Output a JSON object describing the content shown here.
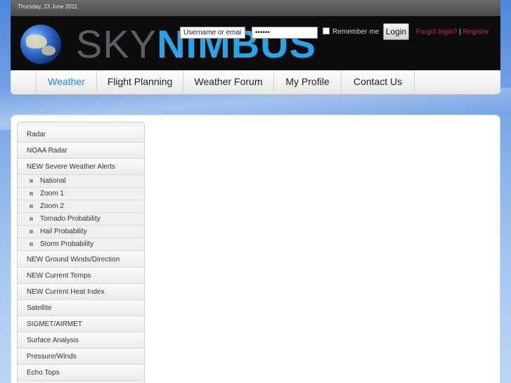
{
  "topbar": {
    "date": "Thursday, 23 June 2011"
  },
  "header": {
    "logo_sky": "SKY",
    "logo_nimbus": "NIMBUS",
    "login": {
      "username_placeholder": "Username or email",
      "password_value": "••••••",
      "remember_label": "Remember me",
      "login_button": "Login",
      "forgot_link": "Forgot login?",
      "separator": "|",
      "register_link": "Register"
    }
  },
  "nav": {
    "items": [
      {
        "label": "Weather",
        "active": true
      },
      {
        "label": "Flight Planning",
        "active": false
      },
      {
        "label": "Weather Forum",
        "active": false
      },
      {
        "label": "My Profile",
        "active": false
      },
      {
        "label": "Contact Us",
        "active": false
      }
    ]
  },
  "sidebar": {
    "items": [
      {
        "label": "Radar"
      },
      {
        "label": "NOAA Radar"
      },
      {
        "label": "NEW Severe Weather Alerts"
      },
      {
        "label": "National",
        "sub": true
      },
      {
        "label": "Zoom 1",
        "sub": true
      },
      {
        "label": "Zoom 2",
        "sub": true
      },
      {
        "label": "Tornado Probability",
        "sub": true
      },
      {
        "label": "Hail Probability",
        "sub": true
      },
      {
        "label": "Storm Probability",
        "sub": true
      },
      {
        "label": "NEW Ground Winds/Direction"
      },
      {
        "label": "NEW Current Temps"
      },
      {
        "label": "NEW Current Heat Index"
      },
      {
        "label": "Satellite"
      },
      {
        "label": "SIGMET/AIRMET"
      },
      {
        "label": "Surface Analysis"
      },
      {
        "label": "Pressure/Winds"
      },
      {
        "label": "Echo Tops"
      }
    ]
  },
  "colors": {
    "accent_blue": "#1f86d9",
    "logo_blue": "#2aa3e8",
    "link_red": "#d8262d"
  }
}
